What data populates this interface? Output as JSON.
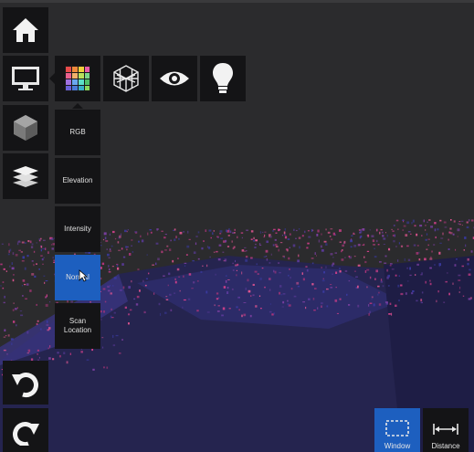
{
  "toolbar": {
    "home_icon": "home-icon",
    "display_icon": "monitor-icon",
    "cube_icon": "cube-icon",
    "layers_icon": "layers-icon",
    "undo_icon": "undo-icon",
    "redo_icon": "redo-icon"
  },
  "display_submenu": {
    "color_icon": "color-palette-icon",
    "wireframe_icon": "wireframe-cube-icon",
    "view_icon": "eye-icon",
    "lighting_icon": "lightbulb-icon"
  },
  "color_modes": {
    "items": [
      {
        "label": "RGB"
      },
      {
        "label": "Elevation"
      },
      {
        "label": "Intensity"
      },
      {
        "label": "Normal"
      },
      {
        "label": "Scan Location"
      }
    ],
    "selected": "Normal"
  },
  "selection_tools": {
    "window_label": "Window",
    "distance_label": "Distance"
  },
  "colors": {
    "background": "#2b2b2d",
    "panel": "#141416",
    "accent": "#1d5fbf",
    "point_pink": "#d0408a",
    "point_blue": "#3a3aa0"
  }
}
